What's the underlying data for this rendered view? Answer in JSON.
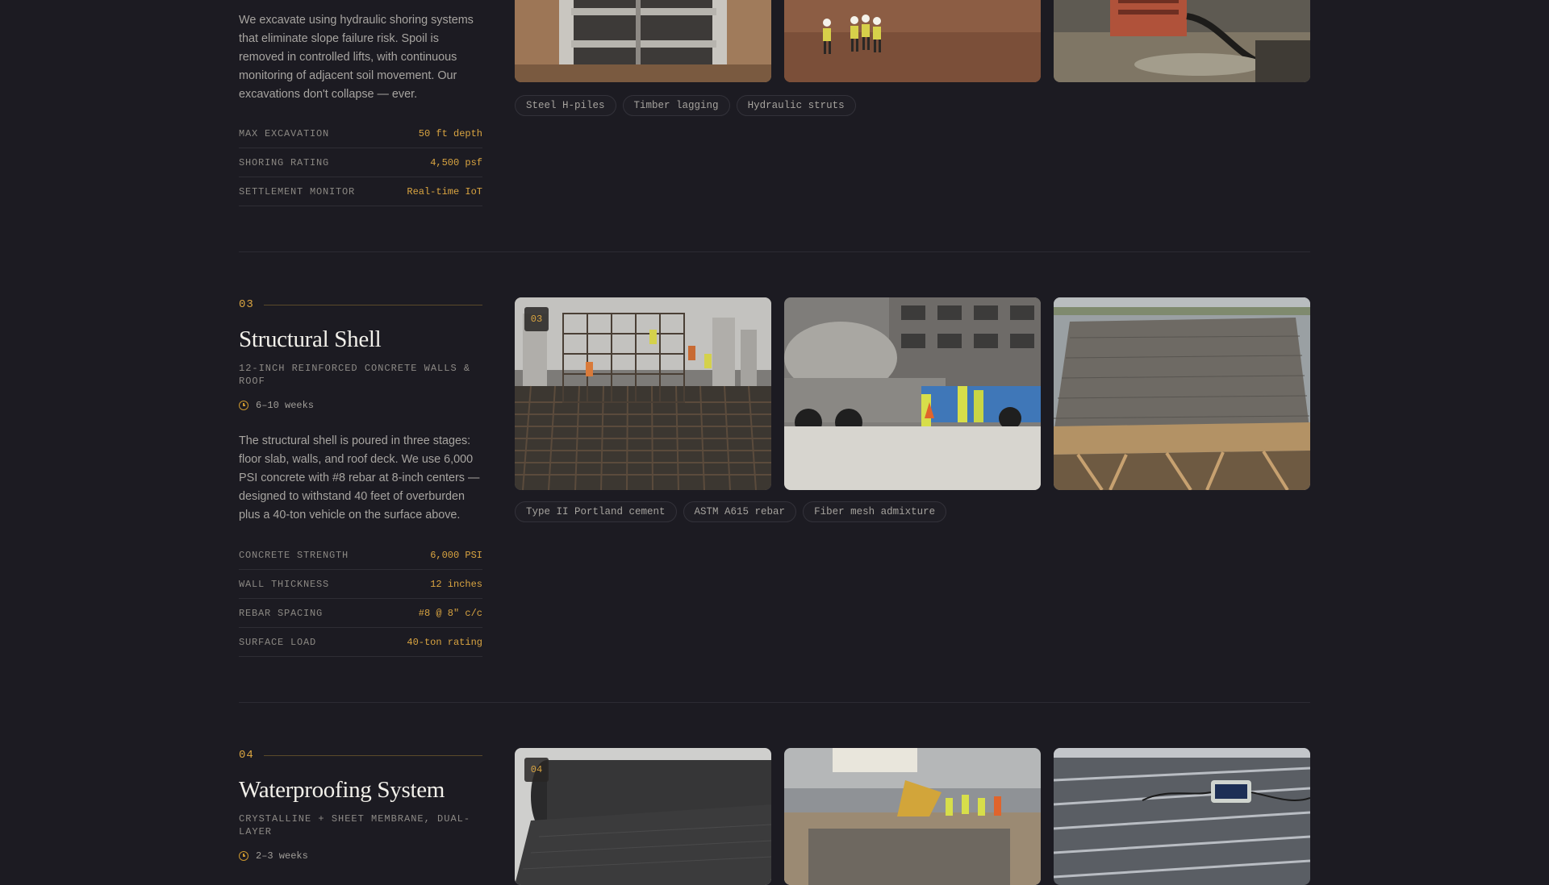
{
  "section2": {
    "description": "We excavate using hydraulic shoring systems that eliminate slope failure risk. Spoil is removed in controlled lifts, with continuous monitoring of adjacent soil movement. Our excavations don't collapse — ever.",
    "specs": [
      {
        "label": "MAX EXCAVATION",
        "value": "50 ft depth"
      },
      {
        "label": "SHORING RATING",
        "value": "4,500 psf"
      },
      {
        "label": "SETTLEMENT MONITOR",
        "value": "Real-time IoT"
      }
    ],
    "tags": [
      "Steel H-piles",
      "Timber lagging",
      "Hydraulic struts"
    ],
    "images": [
      "shoring-frame-photo",
      "site-crew-photo",
      "dewatering-pump-photo"
    ]
  },
  "section3": {
    "number": "03",
    "title": "Structural Shell",
    "subtitle": "12-INCH REINFORCED CONCRETE WALLS & ROOF",
    "duration": "6–10 weeks",
    "description": "The structural shell is poured in three stages: floor slab, walls, and roof deck. We use 6,000 PSI concrete with #8 rebar at 8-inch centers — designed to withstand 40 feet of overburden plus a 40-ton vehicle on the surface above.",
    "specs": [
      {
        "label": "CONCRETE STRENGTH",
        "value": "6,000 PSI"
      },
      {
        "label": "WALL THICKNESS",
        "value": "12 inches"
      },
      {
        "label": "REBAR SPACING",
        "value": "#8 @ 8\" c/c"
      },
      {
        "label": "SURFACE LOAD",
        "value": "40-ton rating"
      }
    ],
    "badge": "03",
    "tags": [
      "Type II Portland cement",
      "ASTM A615 rebar",
      "Fiber mesh admixture"
    ],
    "images": [
      "rebar-cage-photo",
      "concrete-truck-photo",
      "roof-deck-formwork-photo"
    ]
  },
  "section4": {
    "number": "04",
    "title": "Waterproofing System",
    "subtitle": "CRYSTALLINE + SHEET MEMBRANE, DUAL-LAYER",
    "duration": "2–3 weeks",
    "badge": "04",
    "images": [
      "membrane-roll-photo",
      "site-inspection-photo",
      "leak-test-photo"
    ]
  },
  "colors": {
    "background": "#1c1b22",
    "accent": "#d9a441",
    "title": "#f2f0ea",
    "body_text": "#a7a4a0"
  }
}
